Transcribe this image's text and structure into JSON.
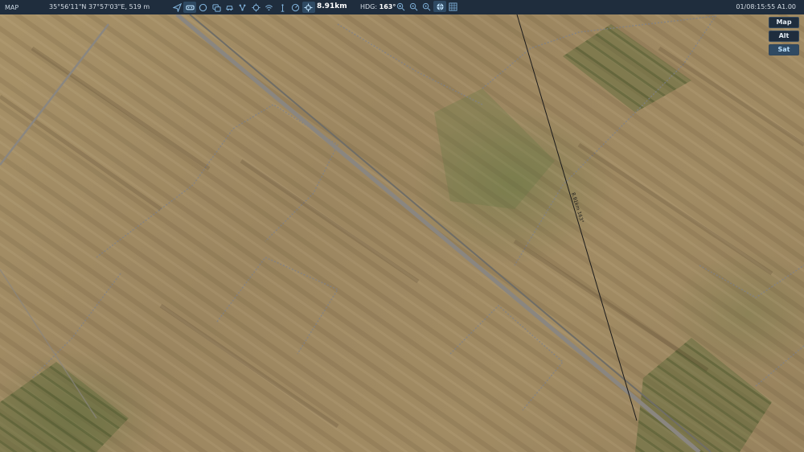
{
  "header": {
    "title": "MAP",
    "coordinates": "35°56'11\"N 37°57'03\"E, 519 m",
    "distance": "8.91km",
    "heading_label": "HDG:",
    "heading_value": "163°",
    "datetime": "01/08:15:55 A1.00"
  },
  "toolbar": {
    "tools": [
      {
        "name": "navigate-icon",
        "active": false
      },
      {
        "name": "vr-icon",
        "active": true
      },
      {
        "name": "circle-icon",
        "active": false
      },
      {
        "name": "layers-icon",
        "active": false
      },
      {
        "name": "vehicle-icon",
        "active": false
      },
      {
        "name": "network-icon",
        "active": false
      },
      {
        "name": "target-icon",
        "active": false
      },
      {
        "name": "wifi-icon",
        "active": false
      },
      {
        "name": "antenna-icon",
        "active": false
      },
      {
        "name": "radar-icon",
        "active": false
      },
      {
        "name": "crosshair-icon",
        "active": true
      }
    ],
    "zoom_tools": [
      {
        "name": "zoom-in-icon"
      },
      {
        "name": "zoom-out-icon"
      },
      {
        "name": "zoom-fit-icon"
      },
      {
        "name": "globe-icon"
      },
      {
        "name": "grid-icon"
      }
    ]
  },
  "layers": {
    "map": "Map",
    "alt": "Alt",
    "sat": "Sat",
    "selected": "Sat"
  },
  "track": {
    "label": "8.91km 163°"
  },
  "colors": {
    "topbar": "#1f2d3d",
    "active": "#2f4a63",
    "road": "#8a8680",
    "track": "#1a1a1a"
  }
}
